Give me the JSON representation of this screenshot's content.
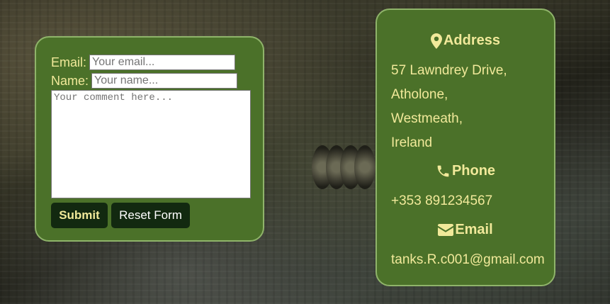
{
  "form": {
    "email_label": "Email:",
    "email_placeholder": "Your email...",
    "name_label": "Name:",
    "name_placeholder": "Your name...",
    "comment_placeholder": "Your comment here...",
    "submit_label": "Submit",
    "reset_label": "Reset Form"
  },
  "contact": {
    "address_heading": "Address",
    "address_lines": [
      "57 Lawndrey Drive,",
      "Atholone,",
      "Westmeath,",
      "Ireland"
    ],
    "phone_heading": "Phone",
    "phone": "+353 891234567",
    "email_heading": "Email",
    "email": "tanks.R.c001@gmail.com"
  },
  "icons": {
    "address": "map-marker-icon",
    "phone": "phone-icon",
    "email": "envelope-icon"
  },
  "colors": {
    "card_bg": "#4b7129",
    "card_border": "#8fb46a",
    "text_accent": "#f1e99a",
    "button_bg": "#122910"
  }
}
